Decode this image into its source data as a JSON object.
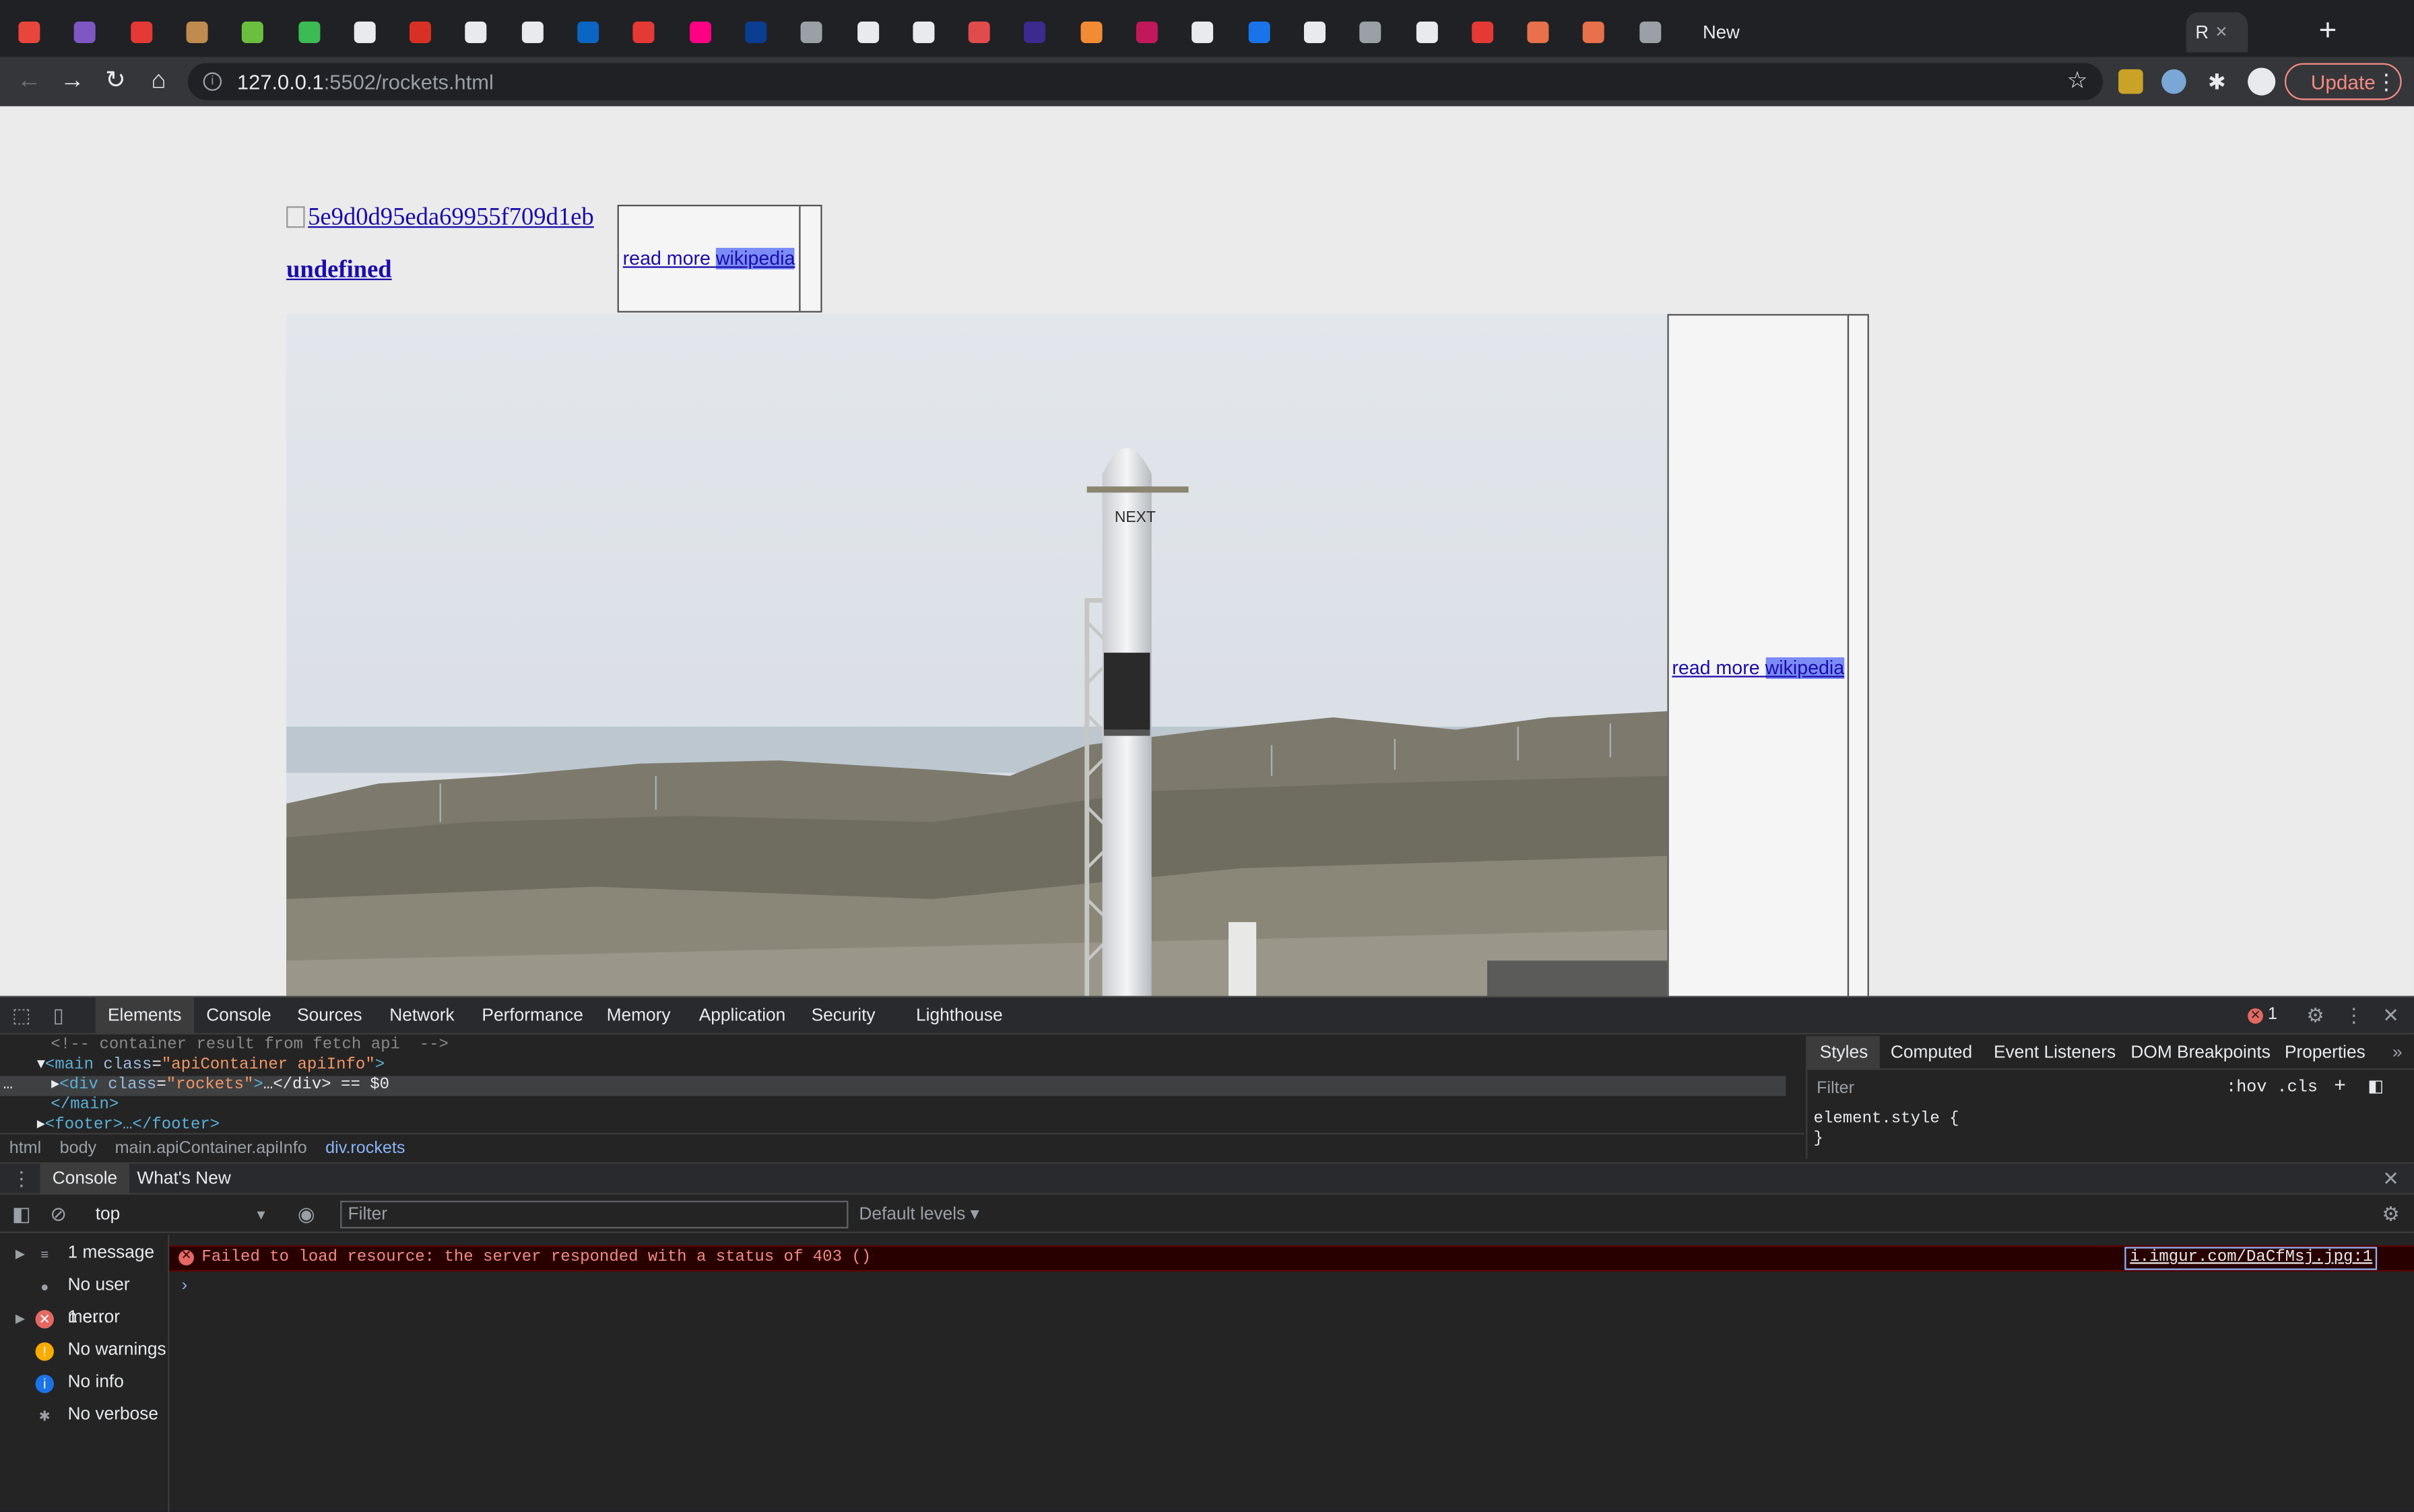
{
  "browser": {
    "active_tab_title": "R",
    "new_tab_label": "New",
    "url_host": "127.0.0.1",
    "url_rest": ":5502/rockets.html",
    "update_label": "Update",
    "tab_favicon_colors": [
      "#e8453c",
      "#7e57c2",
      "#e53935",
      "#c08b4f",
      "#6bbf3e",
      "#3cba54",
      "#e8eaed",
      "#d93025",
      "#e8eaed",
      "#e8eaed",
      "#0a66c2",
      "#e53935",
      "#ff0084",
      "#0b3d91",
      "#9aa0a6",
      "#e8eaed",
      "#e8eaed",
      "#e14b4b",
      "#3c2a8f",
      "#f28b33",
      "#c2185b",
      "#e8eaed",
      "#1a73e8",
      "#e8eaed",
      "#9aa0a6",
      "#e8eaed",
      "#e53935",
      "#e8704a",
      "#e8704a",
      "#9aa0a6"
    ]
  },
  "page": {
    "broken_image_alt": "5e9d0d95eda69955f709d1eb",
    "rocket_name": "undefined",
    "read_more_1": "read more",
    "wiki_1": "wikipedia",
    "read_more_2": "read more",
    "wiki_2": "wikipedia"
  },
  "devtools": {
    "tabs": [
      "Elements",
      "Console",
      "Sources",
      "Network",
      "Performance",
      "Memory",
      "Application",
      "Security",
      "Lighthouse"
    ],
    "error_badge": "1",
    "dom": {
      "comment": "<!-- container result from fetch api  -->",
      "main_open_tag": "main",
      "main_class_attr": "class",
      "main_class_val": "\"apiContainer apiInfo\"",
      "div_tag": "div",
      "div_class_val": "\"rockets\"",
      "div_suffix": "…</div> == $0",
      "main_close": "</main>",
      "footer_line": "<footer>…</footer>"
    },
    "breadcrumbs": [
      "html",
      "body",
      "main.apiContainer.apiInfo",
      "div.rockets"
    ],
    "styles_tabs": [
      "Styles",
      "Computed",
      "Event Listeners",
      "DOM Breakpoints",
      "Properties"
    ],
    "styles_filter_placeholder": "Filter",
    "hov_label": ":hov",
    "cls_label": ".cls",
    "element_style_open": "element.style {",
    "element_style_close": "}",
    "drawer_tabs": [
      "Console",
      "What's New"
    ],
    "context": "top",
    "console_filter_placeholder": "Filter",
    "levels_label": "Default levels ▾",
    "sidebar": [
      {
        "label": "1 message",
        "icon": "list-icon",
        "color": "#9aa0a6"
      },
      {
        "label": "No user me…",
        "icon": "user-icon",
        "color": "#9aa0a6"
      },
      {
        "label": "1 error",
        "icon": "error-icon",
        "color": "#e46962"
      },
      {
        "label": "No warnings",
        "icon": "warning-icon",
        "color": "#f9ab00"
      },
      {
        "label": "No info",
        "icon": "info-icon",
        "color": "#1a73e8"
      },
      {
        "label": "No verbose",
        "icon": "bug-icon",
        "color": "#9aa0a6"
      }
    ],
    "error_message": "Failed to load resource: the server responded with a status of 403 ()",
    "error_source": "i.imgur.com/DaCfMsj.jpg:1"
  }
}
